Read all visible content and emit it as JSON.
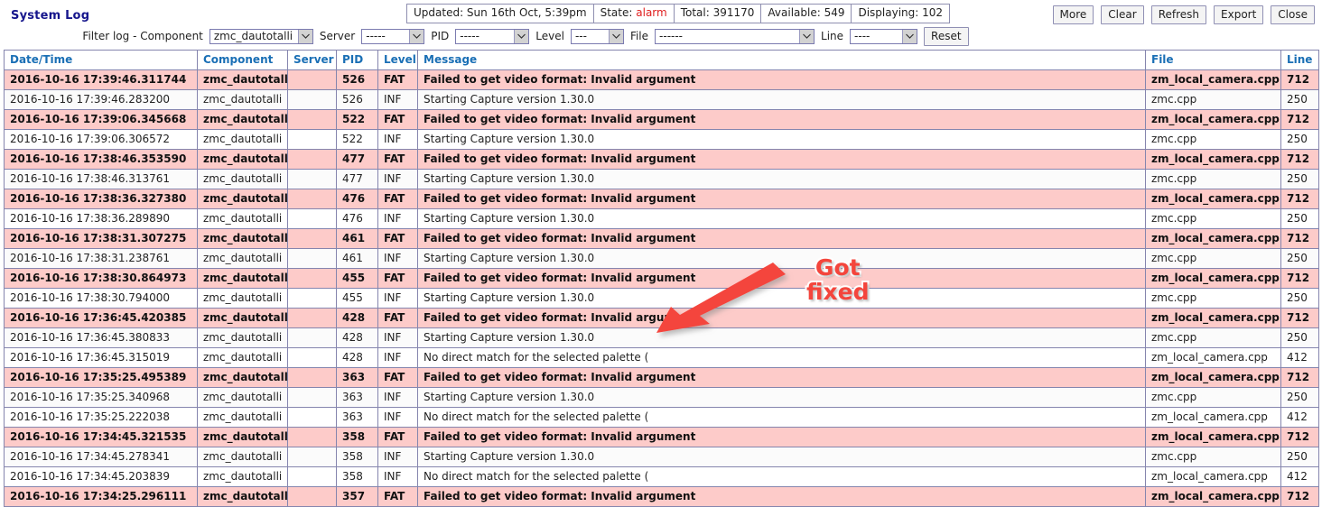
{
  "header": {
    "title": "System Log",
    "status": [
      {
        "label": "Updated: Sun 16th Oct, 5:39pm"
      },
      {
        "label_prefix": "State: ",
        "value": "alarm"
      },
      {
        "label": "Total: 391170"
      },
      {
        "label": "Available: 549"
      },
      {
        "label": "Displaying: 102"
      }
    ],
    "status_updated": "Updated: Sun 16th Oct, 5:39pm",
    "status_state_label": "State:",
    "status_state_value": "alarm",
    "status_total": "Total: 391170",
    "status_available": "Available: 549",
    "status_displaying": "Displaying: 102",
    "buttons": [
      {
        "label": "More"
      },
      {
        "label": "Clear"
      },
      {
        "label": "Refresh"
      },
      {
        "label": "Export"
      },
      {
        "label": "Close"
      }
    ],
    "button_more": "More",
    "button_clear": "Clear",
    "button_refresh": "Refresh",
    "button_export": "Export",
    "button_close": "Close"
  },
  "filter": {
    "intro_label": "Filter log - Component",
    "component_value": "zmc_dautotalli",
    "server_label": "Server",
    "server_value": "-----",
    "pid_label": "PID",
    "pid_value": "-----",
    "level_label": "Level",
    "level_value": "---",
    "file_label": "File",
    "file_value": "------",
    "line_label": "Line",
    "line_value": "----",
    "reset_label": "Reset"
  },
  "table": {
    "columns": [
      "Date/Time",
      "Component",
      "Server",
      "PID",
      "Level",
      "Message",
      "File",
      "Line"
    ],
    "rows": [
      {
        "datetime": "2016-10-16 17:39:46.311744",
        "component": "zmc_dautotalli",
        "server": "",
        "pid": "526",
        "level": "FAT",
        "message": "Failed to get video format: Invalid argument",
        "file": "zm_local_camera.cpp",
        "line": "712"
      },
      {
        "datetime": "2016-10-16 17:39:46.283200",
        "component": "zmc_dautotalli",
        "server": "",
        "pid": "526",
        "level": "INF",
        "message": "Starting Capture version 1.30.0",
        "file": "zmc.cpp",
        "line": "250"
      },
      {
        "datetime": "2016-10-16 17:39:06.345668",
        "component": "zmc_dautotalli",
        "server": "",
        "pid": "522",
        "level": "FAT",
        "message": "Failed to get video format: Invalid argument",
        "file": "zm_local_camera.cpp",
        "line": "712"
      },
      {
        "datetime": "2016-10-16 17:39:06.306572",
        "component": "zmc_dautotalli",
        "server": "",
        "pid": "522",
        "level": "INF",
        "message": "Starting Capture version 1.30.0",
        "file": "zmc.cpp",
        "line": "250"
      },
      {
        "datetime": "2016-10-16 17:38:46.353590",
        "component": "zmc_dautotalli",
        "server": "",
        "pid": "477",
        "level": "FAT",
        "message": "Failed to get video format: Invalid argument",
        "file": "zm_local_camera.cpp",
        "line": "712"
      },
      {
        "datetime": "2016-10-16 17:38:46.313761",
        "component": "zmc_dautotalli",
        "server": "",
        "pid": "477",
        "level": "INF",
        "message": "Starting Capture version 1.30.0",
        "file": "zmc.cpp",
        "line": "250"
      },
      {
        "datetime": "2016-10-16 17:38:36.327380",
        "component": "zmc_dautotalli",
        "server": "",
        "pid": "476",
        "level": "FAT",
        "message": "Failed to get video format: Invalid argument",
        "file": "zm_local_camera.cpp",
        "line": "712"
      },
      {
        "datetime": "2016-10-16 17:38:36.289890",
        "component": "zmc_dautotalli",
        "server": "",
        "pid": "476",
        "level": "INF",
        "message": "Starting Capture version 1.30.0",
        "file": "zmc.cpp",
        "line": "250"
      },
      {
        "datetime": "2016-10-16 17:38:31.307275",
        "component": "zmc_dautotalli",
        "server": "",
        "pid": "461",
        "level": "FAT",
        "message": "Failed to get video format: Invalid argument",
        "file": "zm_local_camera.cpp",
        "line": "712"
      },
      {
        "datetime": "2016-10-16 17:38:31.238761",
        "component": "zmc_dautotalli",
        "server": "",
        "pid": "461",
        "level": "INF",
        "message": "Starting Capture version 1.30.0",
        "file": "zmc.cpp",
        "line": "250"
      },
      {
        "datetime": "2016-10-16 17:38:30.864973",
        "component": "zmc_dautotalli",
        "server": "",
        "pid": "455",
        "level": "FAT",
        "message": "Failed to get video format: Invalid argument",
        "file": "zm_local_camera.cpp",
        "line": "712"
      },
      {
        "datetime": "2016-10-16 17:38:30.794000",
        "component": "zmc_dautotalli",
        "server": "",
        "pid": "455",
        "level": "INF",
        "message": "Starting Capture version 1.30.0",
        "file": "zmc.cpp",
        "line": "250"
      },
      {
        "datetime": "2016-10-16 17:36:45.420385",
        "component": "zmc_dautotalli",
        "server": "",
        "pid": "428",
        "level": "FAT",
        "message": "Failed to get video format: Invalid argument",
        "file": "zm_local_camera.cpp",
        "line": "712"
      },
      {
        "datetime": "2016-10-16 17:36:45.380833",
        "component": "zmc_dautotalli",
        "server": "",
        "pid": "428",
        "level": "INF",
        "message": "Starting Capture version 1.30.0",
        "file": "zmc.cpp",
        "line": "250"
      },
      {
        "datetime": "2016-10-16 17:36:45.315019",
        "component": "zmc_dautotalli",
        "server": "",
        "pid": "428",
        "level": "INF",
        "message": "No direct match for the selected palette (",
        "file": "zm_local_camera.cpp",
        "line": "412"
      },
      {
        "datetime": "2016-10-16 17:35:25.495389",
        "component": "zmc_dautotalli",
        "server": "",
        "pid": "363",
        "level": "FAT",
        "message": "Failed to get video format: Invalid argument",
        "file": "zm_local_camera.cpp",
        "line": "712"
      },
      {
        "datetime": "2016-10-16 17:35:25.340968",
        "component": "zmc_dautotalli",
        "server": "",
        "pid": "363",
        "level": "INF",
        "message": "Starting Capture version 1.30.0",
        "file": "zmc.cpp",
        "line": "250"
      },
      {
        "datetime": "2016-10-16 17:35:25.222038",
        "component": "zmc_dautotalli",
        "server": "",
        "pid": "363",
        "level": "INF",
        "message": "No direct match for the selected palette (",
        "file": "zm_local_camera.cpp",
        "line": "412"
      },
      {
        "datetime": "2016-10-16 17:34:45.321535",
        "component": "zmc_dautotalli",
        "server": "",
        "pid": "358",
        "level": "FAT",
        "message": "Failed to get video format: Invalid argument",
        "file": "zm_local_camera.cpp",
        "line": "712"
      },
      {
        "datetime": "2016-10-16 17:34:45.278341",
        "component": "zmc_dautotalli",
        "server": "",
        "pid": "358",
        "level": "INF",
        "message": "Starting Capture version 1.30.0",
        "file": "zmc.cpp",
        "line": "250"
      },
      {
        "datetime": "2016-10-16 17:34:45.203839",
        "component": "zmc_dautotalli",
        "server": "",
        "pid": "358",
        "level": "INF",
        "message": "No direct match for the selected palette (",
        "file": "zm_local_camera.cpp",
        "line": "412"
      },
      {
        "datetime": "2016-10-16 17:34:25.296111",
        "component": "zmc_dautotalli",
        "server": "",
        "pid": "357",
        "level": "FAT",
        "message": "Failed to get video format: Invalid argument",
        "file": "zm_local_camera.cpp",
        "line": "712"
      }
    ]
  },
  "annotation": {
    "line1": "Got",
    "line2": "fixed",
    "color": "#f4453c"
  },
  "colors": {
    "fatal_row_background": "#fdcbc9",
    "header_text": "#1a6fb5",
    "title_text": "#16168c",
    "alarm_text": "#e02020",
    "border": "#8585ae"
  }
}
